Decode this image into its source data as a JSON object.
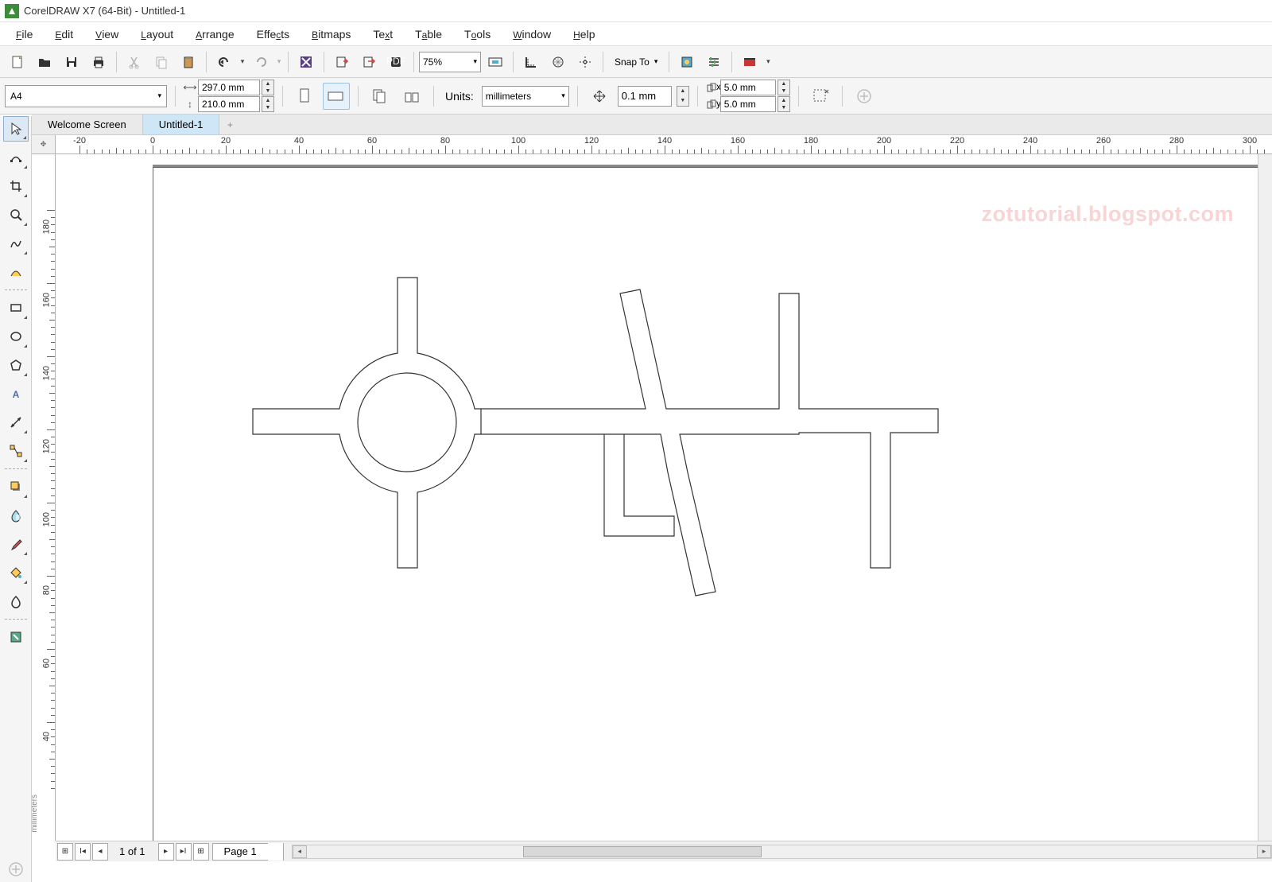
{
  "title": "CorelDRAW X7 (64-Bit) - Untitled-1",
  "menu": [
    "File",
    "Edit",
    "View",
    "Layout",
    "Arrange",
    "Effects",
    "Bitmaps",
    "Text",
    "Table",
    "Tools",
    "Window",
    "Help"
  ],
  "toolbar": {
    "zoom": "75%",
    "snap_to": "Snap To"
  },
  "propbar": {
    "page_size": "A4",
    "width": "297.0 mm",
    "height": "210.0 mm",
    "units_label": "Units:",
    "units": "millimeters",
    "nudge": "0.1 mm",
    "dup_x": "5.0 mm",
    "dup_y": "5.0 mm"
  },
  "tabs": {
    "welcome": "Welcome Screen",
    "doc1": "Untitled-1"
  },
  "ruler": {
    "h_ticks": [
      -20,
      0,
      20,
      40,
      60,
      80,
      100,
      120,
      140,
      160,
      180,
      200,
      220,
      240,
      260,
      280,
      300
    ],
    "v_ticks": [
      180,
      160,
      140,
      120,
      100,
      80,
      60,
      40
    ],
    "v_label": "millimeters"
  },
  "watermark": "zotutorial.blogspot.com",
  "pagenav": {
    "counter": "1 of 1",
    "page_label": "Page 1"
  }
}
